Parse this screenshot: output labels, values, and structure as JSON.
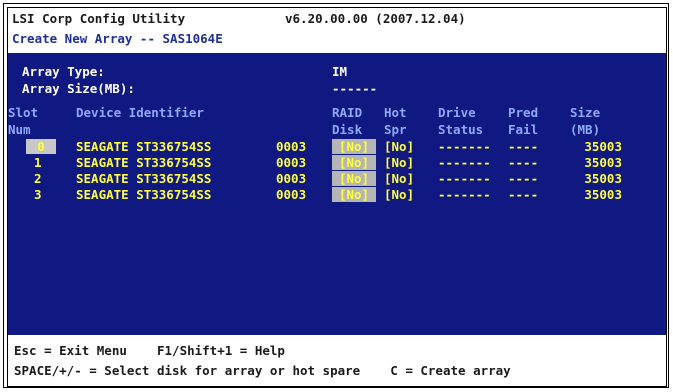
{
  "header": {
    "app_title": "LSI Corp Config Utility",
    "version": "v6.20.00.00 (2007.12.04)",
    "subtitle": "Create New Array -- SAS1064E"
  },
  "array": {
    "type_label": "Array Type:",
    "type_value": "IM",
    "size_label": "Array Size(MB):",
    "size_value": "------"
  },
  "columns": {
    "slot_1": "Slot",
    "slot_2": "Num",
    "device_1": "Device Identifier",
    "raid_1": "RAID",
    "raid_2": "Disk",
    "hot_1": "Hot",
    "hot_2": "Spr",
    "drive_1": "Drive",
    "drive_2": "Status",
    "pred_1": "Pred",
    "pred_2": "Fail",
    "size_1": "Size",
    "size_2": "(MB)"
  },
  "rows": [
    {
      "slot": "0",
      "device": "SEAGATE ST336754SS",
      "rev": "0003",
      "raid": "[No]",
      "hot": "[No]",
      "status": "-------",
      "pred": "----",
      "size": "35003"
    },
    {
      "slot": "1",
      "device": "SEAGATE ST336754SS",
      "rev": "0003",
      "raid": "[No]",
      "hot": "[No]",
      "status": "-------",
      "pred": "----",
      "size": "35003"
    },
    {
      "slot": "2",
      "device": "SEAGATE ST336754SS",
      "rev": "0003",
      "raid": "[No]",
      "hot": "[No]",
      "status": "-------",
      "pred": "----",
      "size": "35003"
    },
    {
      "slot": "3",
      "device": "SEAGATE ST336754SS",
      "rev": "0003",
      "raid": "[No]",
      "hot": "[No]",
      "status": "-------",
      "pred": "----",
      "size": "35003"
    }
  ],
  "footer": {
    "line1": "Esc = Exit Menu    F1/Shift+1 = Help",
    "line2": "SPACE/+/- = Select disk for array or hot spare    C = Create array"
  },
  "colors": {
    "background": "#101882",
    "header_text": "#1e2f9c",
    "highlight_text": "#ffff3c",
    "column_header_text": "#8fa9ff",
    "selection_bg": "#b5b5b5"
  }
}
